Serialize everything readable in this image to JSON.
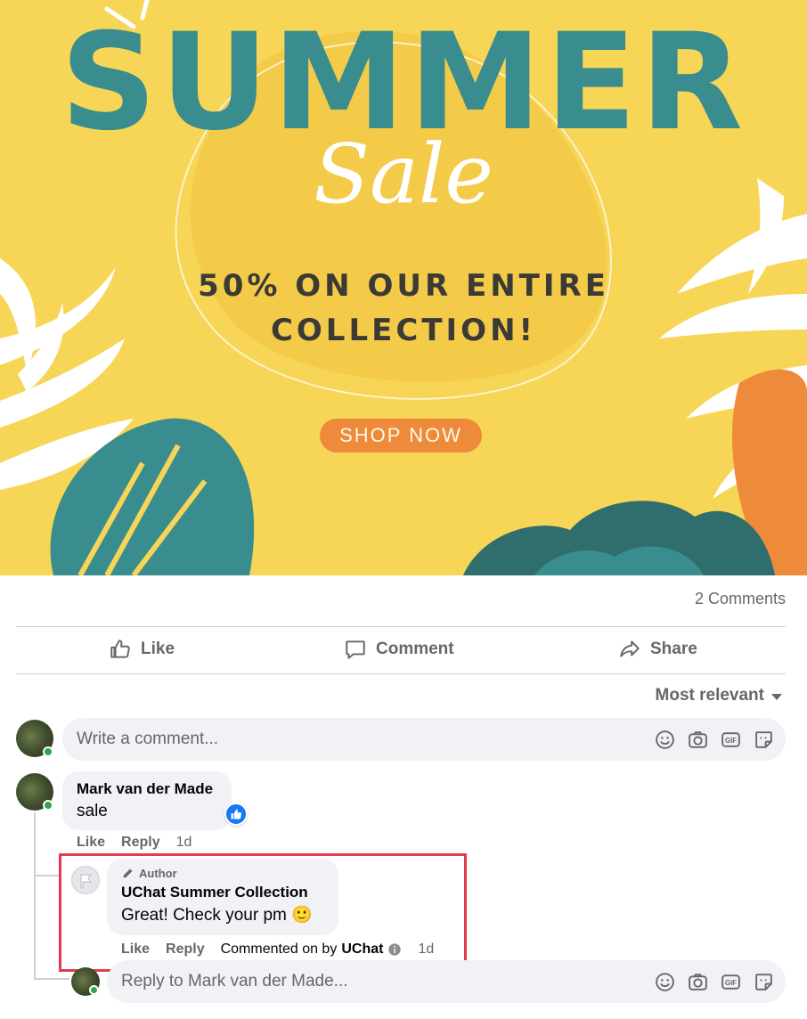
{
  "banner": {
    "title": "SUMMER",
    "subtitle": "Sale",
    "offer_line1": "50% ON OUR ENTIRE",
    "offer_line2": "COLLECTION!",
    "cta": "SHOP NOW",
    "colors": {
      "background": "#f7d556",
      "accent": "#3a8d8e",
      "cta": "#ed8b3a"
    }
  },
  "post": {
    "comment_count": "2 Comments",
    "actions": {
      "like": "Like",
      "comment": "Comment",
      "share": "Share"
    },
    "sort_label": "Most relevant"
  },
  "composer": {
    "placeholder": "Write a comment...",
    "icons": [
      "emoji-icon",
      "camera-icon",
      "gif-icon",
      "sticker-icon"
    ]
  },
  "comments": [
    {
      "name": "Mark van der Made",
      "text": "sale",
      "like_label": "Like",
      "reply_label": "Reply",
      "time": "1d",
      "replies": [
        {
          "badge": "Author",
          "name": "UChat Summer Collection",
          "text": "Great! Check your pm 🙂",
          "like_label": "Like",
          "reply_label": "Reply",
          "commented_on_by": "Commented on by",
          "via": "UChat",
          "time": "1d"
        }
      ]
    }
  ],
  "reply_composer": {
    "placeholder": "Reply to Mark van der Made..."
  }
}
